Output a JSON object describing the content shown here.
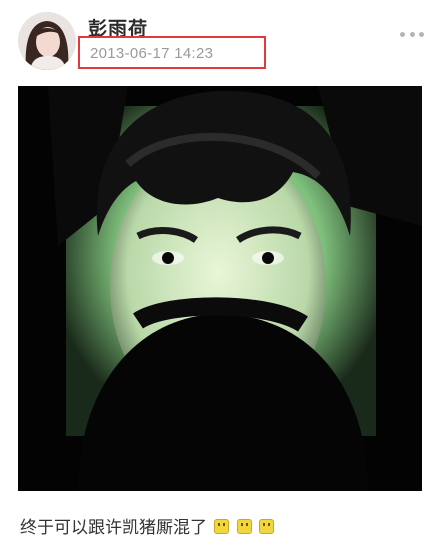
{
  "post": {
    "author": "彭雨荷",
    "timestamp": "2013-06-17 14:23",
    "caption": "终于可以跟许凯猪厮混了",
    "emoji_count": 3,
    "emoji_icon": "grinning-face-emoji"
  },
  "highlight_color": "#e23a3a"
}
